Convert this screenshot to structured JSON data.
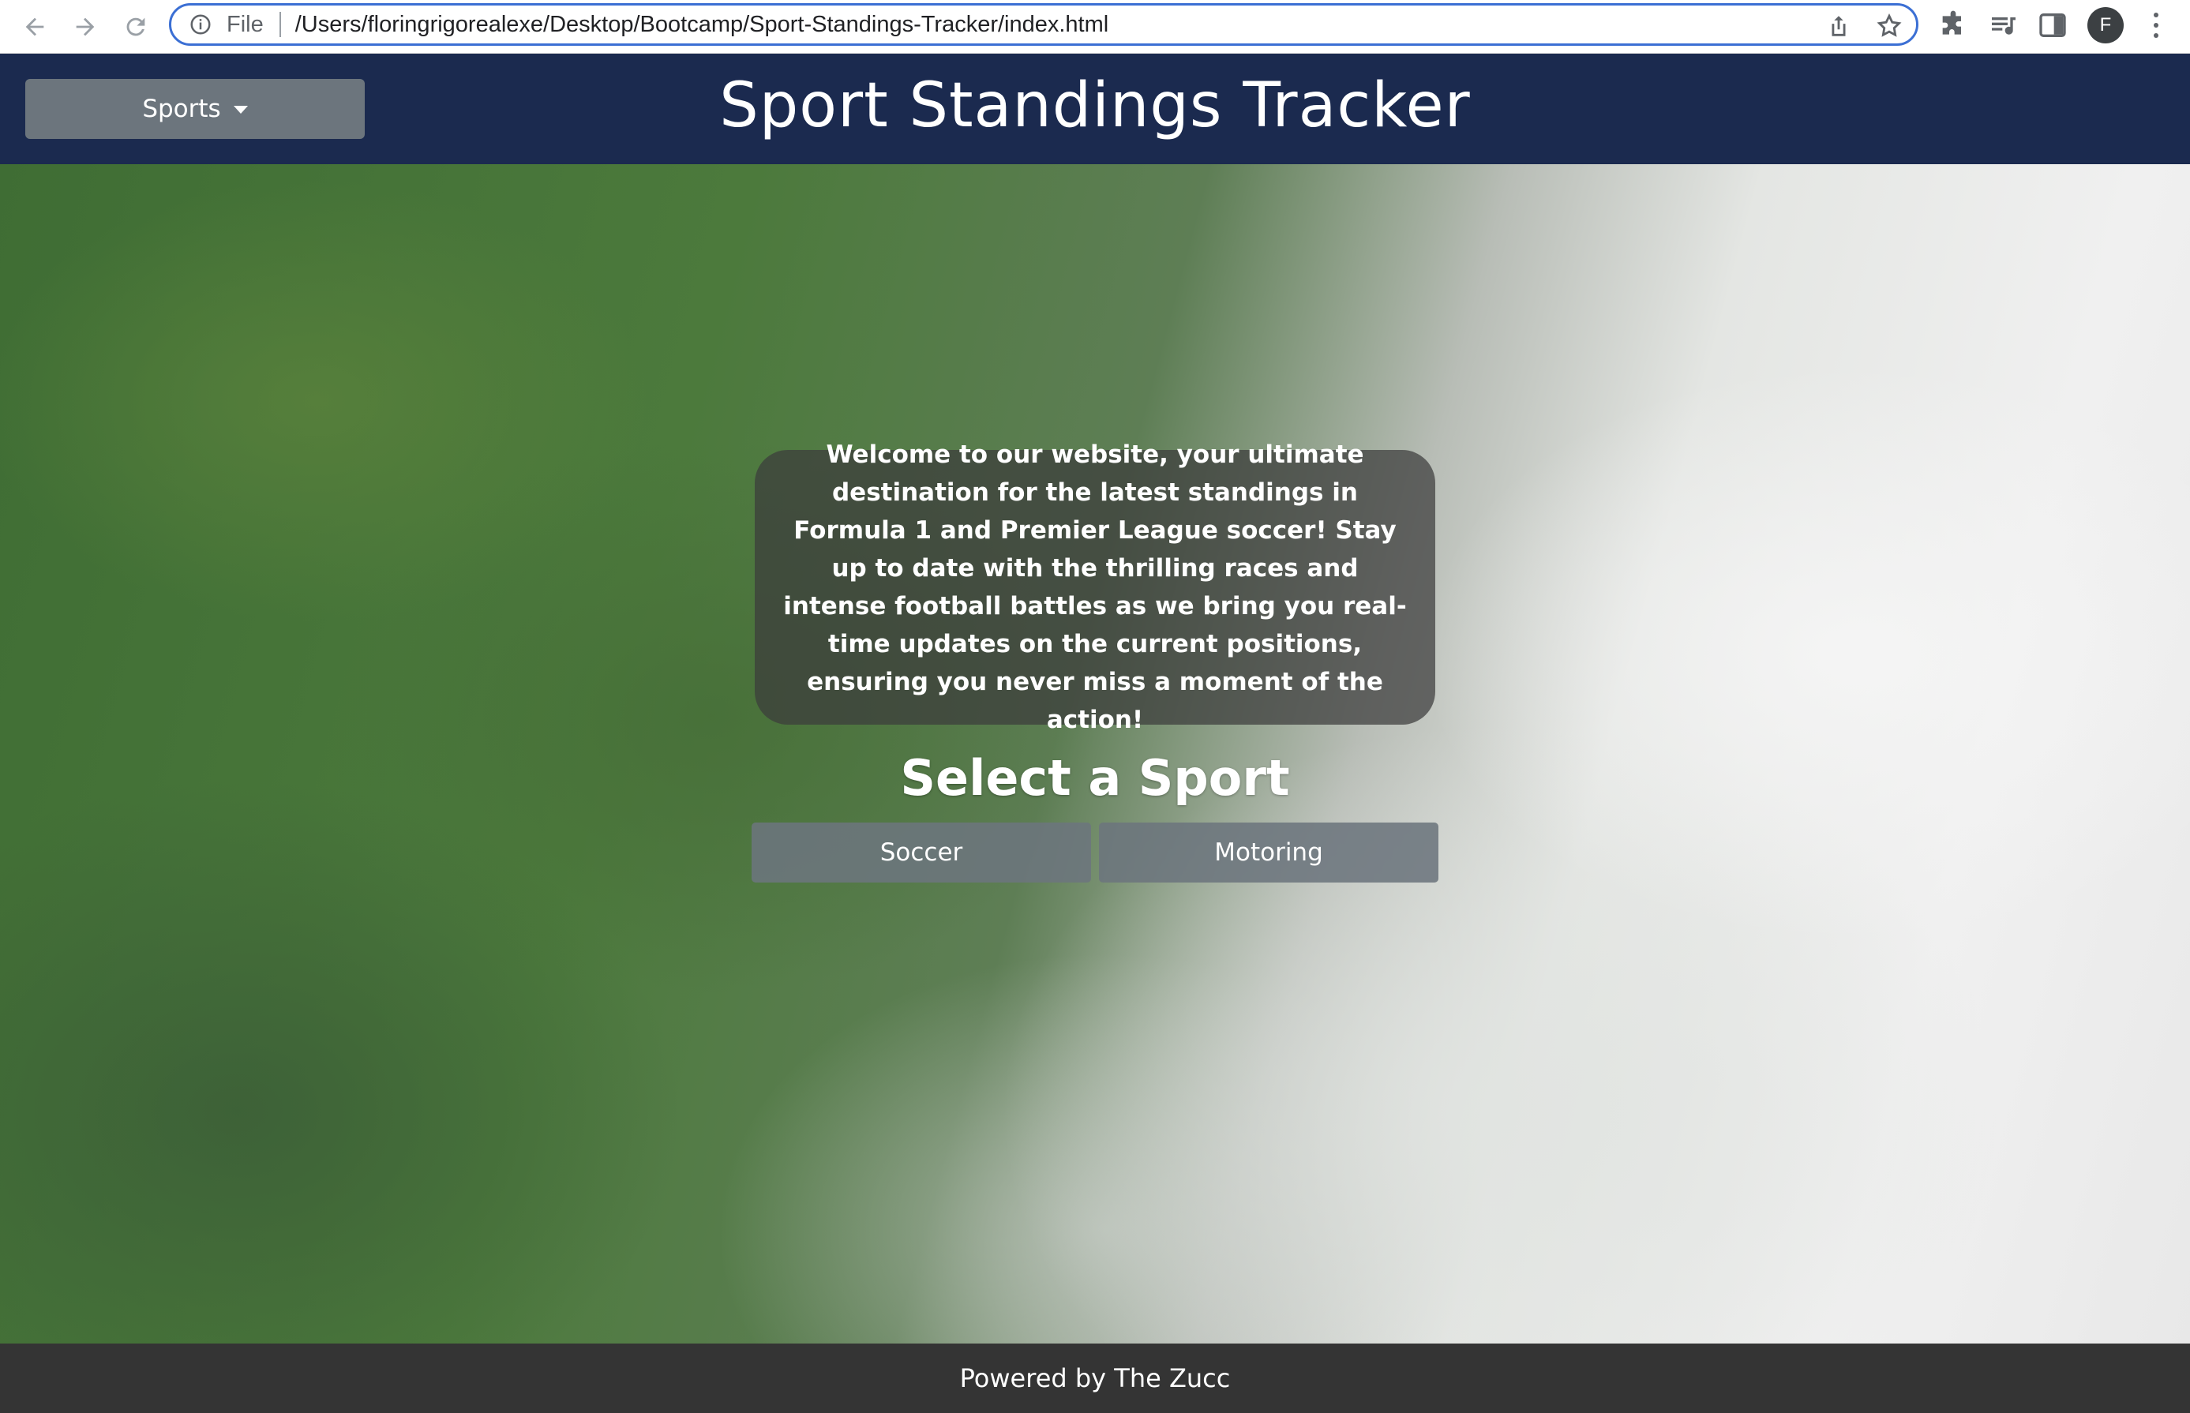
{
  "browser": {
    "file_label": "File",
    "url": "/Users/floringrigorealexe/Desktop/Bootcamp/Sport-Standings-Tracker/index.html",
    "profile_initial": "F"
  },
  "header": {
    "dropdown_label": "Sports",
    "title": "Sport Standings Tracker"
  },
  "main": {
    "welcome_text": "Welcome to our website, your ultimate destination for the latest standings in Formula 1 and Premier League soccer! Stay up to date with the thrilling races and intense football battles as we bring you real-time updates on the current positions, ensuring you never miss a moment of the action!",
    "select_title": "Select a Sport",
    "buttons": [
      {
        "label": "Soccer"
      },
      {
        "label": "Motoring"
      }
    ]
  },
  "footer": {
    "text": "Powered by The Zucc"
  },
  "colors": {
    "header_bg": "#1b2a4f",
    "button_bg": "#6c757d",
    "footer_bg": "#343434"
  }
}
